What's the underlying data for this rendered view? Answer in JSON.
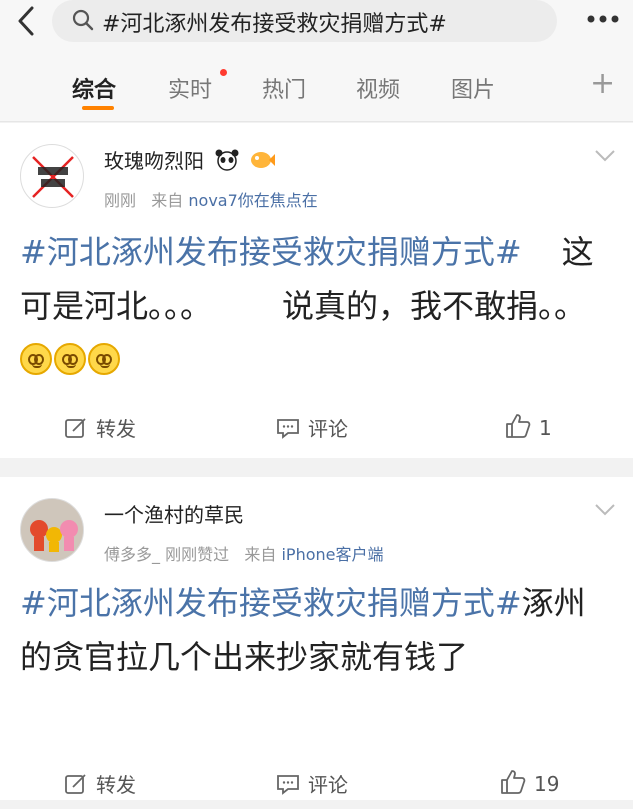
{
  "search": {
    "query": "#河北涿州发布接受救灾捐赠方式#"
  },
  "tabs": [
    {
      "label": "综合"
    },
    {
      "label": "实时"
    },
    {
      "label": "热门"
    },
    {
      "label": "视频"
    },
    {
      "label": "图片"
    }
  ],
  "posts": [
    {
      "username": "玫瑰吻烈阳",
      "time": "刚刚",
      "via": "来自",
      "source": "nova7你在焦点在",
      "hashtag": "#河北涿州发布接受救灾捐赠方式#",
      "text1": "这可是河北。。。",
      "text2": "说真的，我不敢捐。。",
      "repost": "转发",
      "comment": "评论",
      "likes": "1"
    },
    {
      "username": "一个渔村的草民",
      "liked_by": "傅多多_ 刚刚赞过",
      "via": "来自",
      "source": "iPhone客户端",
      "hashtag": "#河北涿州发布接受救灾捐赠方式#",
      "text": "涿州的贪官拉几个出来抄家就有钱了",
      "repost": "转发",
      "comment": "评论",
      "likes": "19"
    }
  ],
  "colors": {
    "accent": "#ff8200",
    "hashtag": "#4a73a8",
    "source": "#4a6fa5"
  }
}
